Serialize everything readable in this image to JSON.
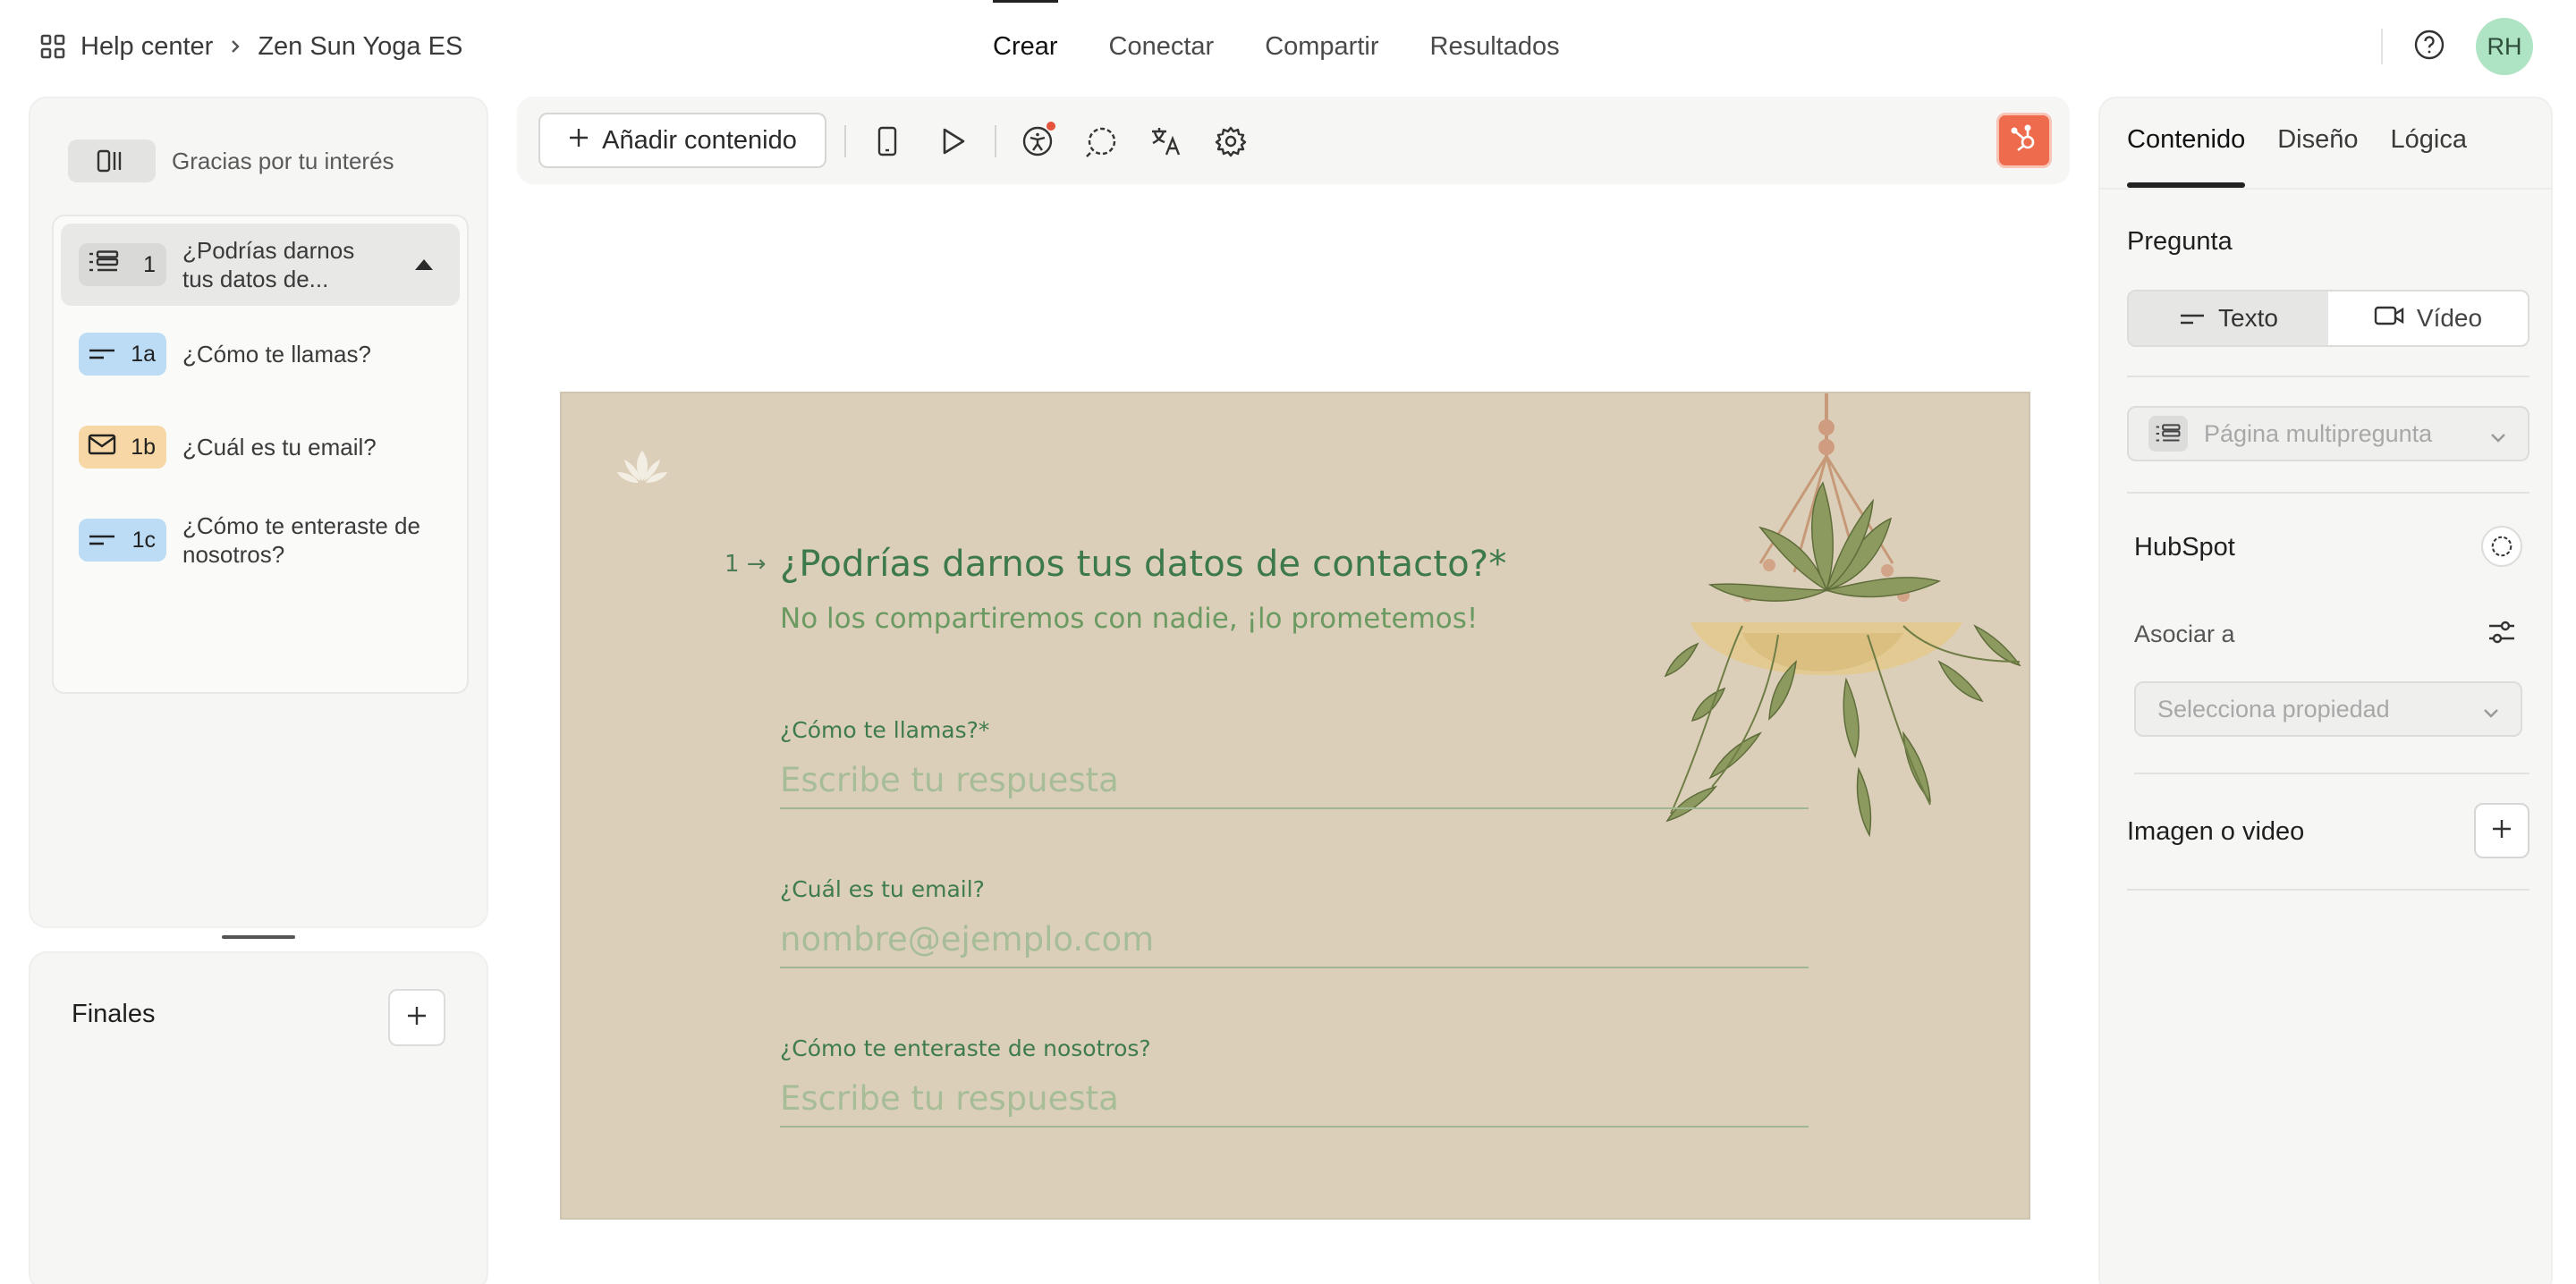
{
  "breadcrumb": {
    "root": "Help center",
    "current": "Zen Sun Yoga ES"
  },
  "nav": {
    "tabs": [
      "Crear",
      "Conectar",
      "Compartir",
      "Resultados"
    ],
    "active": "Crear"
  },
  "user": {
    "initials": "RH"
  },
  "sidebar": {
    "welcome": "Gracias por tu interés",
    "group": {
      "number": "1",
      "label": "¿Podrías darnos tus datos de..."
    },
    "subitems": [
      {
        "number": "1a",
        "label": "¿Cómo te llamas?",
        "type": "text"
      },
      {
        "number": "1b",
        "label": "¿Cuál es tu email?",
        "type": "email"
      },
      {
        "number": "1c",
        "label": "¿Cómo te enteraste de nosotros?",
        "type": "text"
      }
    ],
    "finals_title": "Finales"
  },
  "toolbar": {
    "add_label": "Añadir contenido"
  },
  "preview": {
    "number": "1",
    "title": "¿Podrías darnos tus datos de contacto?*",
    "description": "No los compartiremos con nadie, ¡lo prometemos!",
    "fields": [
      {
        "label": "¿Cómo te llamas?*",
        "placeholder": "Escribe tu respuesta"
      },
      {
        "label": "¿Cuál es tu email?",
        "placeholder": "nombre@ejemplo.com"
      },
      {
        "label": "¿Cómo te enteraste de nosotros?",
        "placeholder": "Escribe tu respuesta"
      }
    ],
    "colors": {
      "background": "#dccfb9",
      "title": "#3d7a4a",
      "description": "#6b9a62"
    }
  },
  "right_panel": {
    "tabs": [
      "Contenido",
      "Diseño",
      "Lógica"
    ],
    "active_tab": "Contenido",
    "question_heading": "Pregunta",
    "type_options": {
      "text": "Texto",
      "video": "Vídeo",
      "selected": "Texto"
    },
    "page_type": "Página multipregunta",
    "hubspot": {
      "title": "HubSpot",
      "associate_label": "Asociar a",
      "property_placeholder": "Selecciona propiedad"
    },
    "media_title": "Imagen o video"
  },
  "accent": {
    "hubspot": "#ee6c4d",
    "avatar": "#aee3c4",
    "chip_blue": "#bcdcf6",
    "chip_orange": "#f6d7a5"
  }
}
